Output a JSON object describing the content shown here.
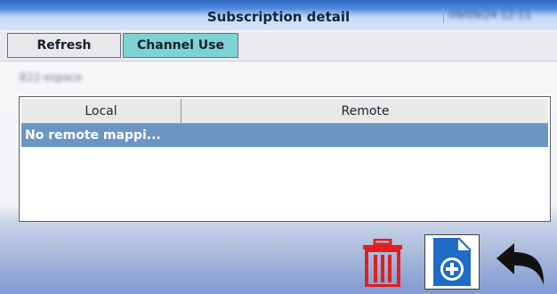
{
  "window": {
    "title": "Subscription detail",
    "datetime": "09/09/24 12:11"
  },
  "tabs": [
    {
      "label": "Refresh"
    },
    {
      "label": "Channel Use"
    }
  ],
  "subscription": {
    "name": "B22-espace"
  },
  "table": {
    "columns": [
      "Local",
      "Remote"
    ],
    "rows": [
      {
        "text": "No remote mappi..."
      }
    ]
  },
  "actions": {
    "delete_icon": "trash-icon",
    "add_icon": "new-document-icon",
    "back_icon": "back-arrow-icon",
    "delete_color": "#e02020",
    "add_color": "#1f6cc7"
  }
}
